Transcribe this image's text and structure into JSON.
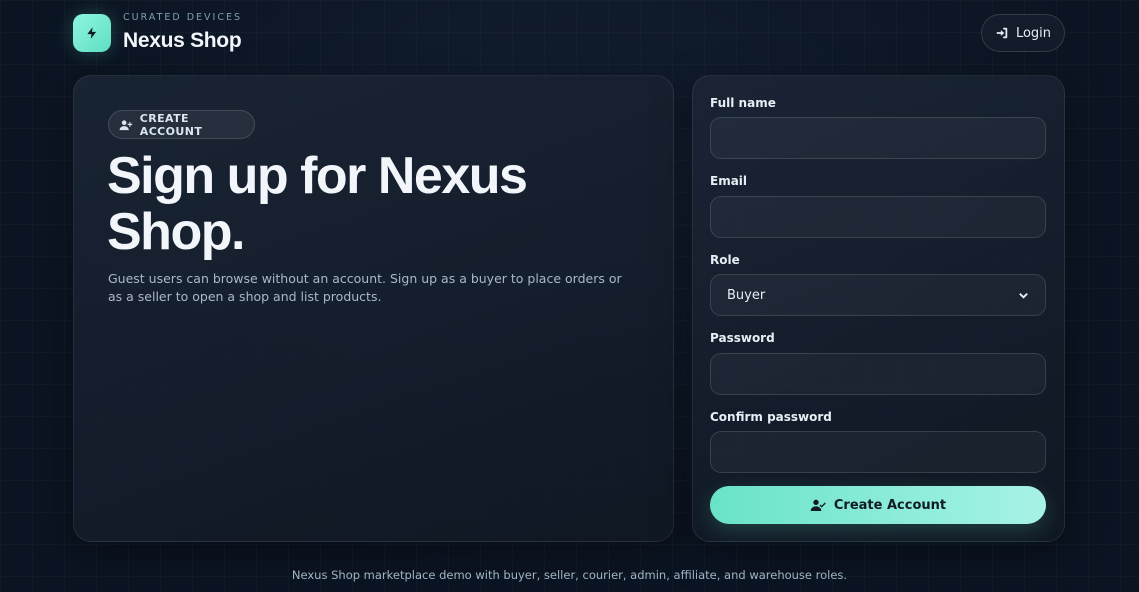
{
  "brand": {
    "eyebrow": "CURATED DEVICES",
    "name": "Nexus Shop",
    "logo_icon": "lightning-bolt-icon"
  },
  "header": {
    "login_label": "Login",
    "login_icon": "login-icon"
  },
  "hero": {
    "badge_label": "CREATE ACCOUNT",
    "badge_icon": "user-plus-icon",
    "title": "Sign up for Nexus Shop.",
    "subtitle": "Guest users can browse without an account. Sign up as a buyer to place orders or as a seller to open a shop and list products."
  },
  "form": {
    "full_name": {
      "label": "Full name",
      "value": ""
    },
    "email": {
      "label": "Email",
      "value": ""
    },
    "role": {
      "label": "Role",
      "value": "Buyer"
    },
    "password": {
      "label": "Password",
      "value": ""
    },
    "confirm_password": {
      "label": "Confirm password",
      "value": ""
    },
    "submit_label": "Create Account",
    "submit_icon": "user-check-icon"
  },
  "footer": {
    "text": "Nexus Shop marketplace demo with buyer, seller, courier, admin, affiliate, and warehouse roles."
  },
  "colors": {
    "accent": "#69e3c8",
    "background": "#0b1422",
    "card": "#1a2434"
  }
}
